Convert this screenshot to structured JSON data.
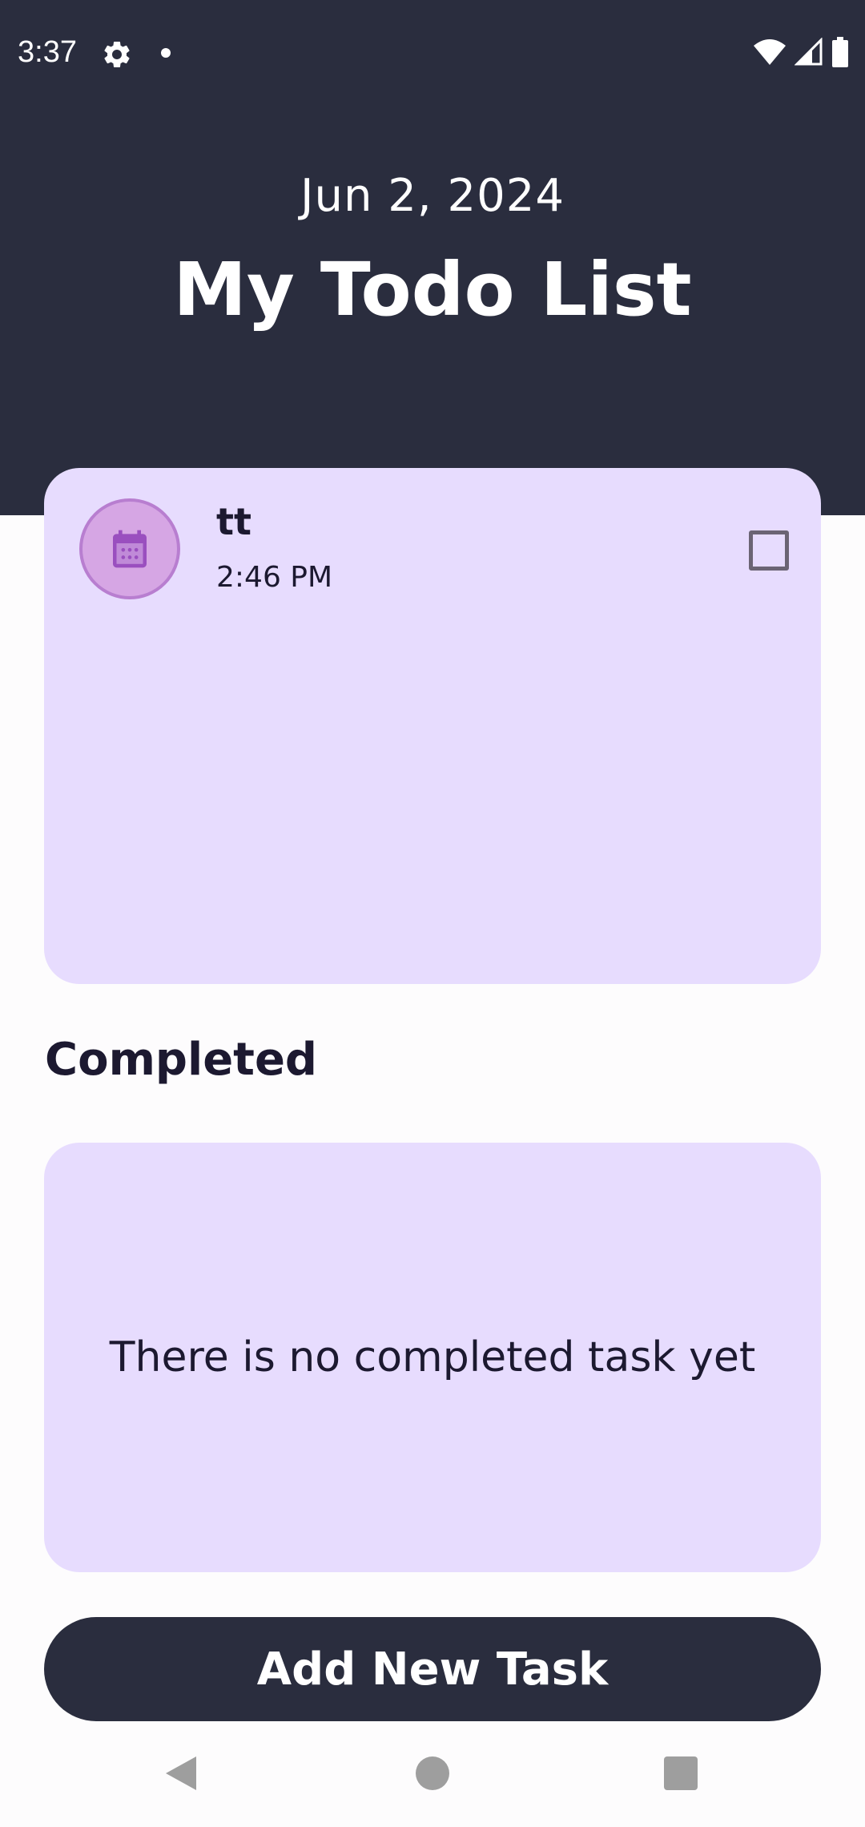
{
  "status_bar": {
    "time": "3:37"
  },
  "header": {
    "date": "Jun 2, 2024",
    "title": "My Todo List"
  },
  "task": {
    "title": "tt",
    "time": "2:46 PM",
    "icon": "calendar-icon",
    "checked": false
  },
  "completed": {
    "heading": "Completed",
    "empty_message": "There is no completed task yet"
  },
  "add_button": {
    "label": "Add New Task"
  },
  "colors": {
    "header_bg": "#2a2d3e",
    "card_bg": "#e7dcfe",
    "avatar_bg": "#d6a6e4",
    "text_dark": "#1c1930"
  }
}
